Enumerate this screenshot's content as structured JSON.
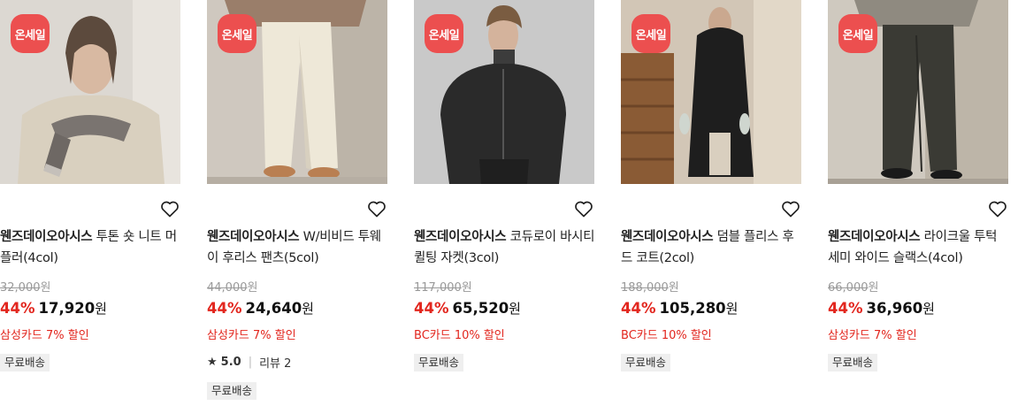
{
  "colors": {
    "sale_badge": "#ec4f4f",
    "discount": "#e2261e",
    "shipping_bg": "#efefef"
  },
  "products": [
    {
      "badge": "온세일",
      "brand": "웬즈데이오아시스",
      "name": " 투톤 숏 니트 머플러(4col)",
      "original_price": "32,000",
      "original_unit": "원",
      "discount": "44%",
      "price": "17,920",
      "price_unit": "원",
      "promo": "삼성카드 7% 할인",
      "rating": null,
      "shipping": "무료배송",
      "icons": [
        "heart-icon"
      ]
    },
    {
      "badge": "온세일",
      "brand": "웬즈데이오아시스",
      "name": " W/비비드 투웨이 후리스 팬츠(5col)",
      "original_price": "44,000",
      "original_unit": "원",
      "discount": "44%",
      "price": "24,640",
      "price_unit": "원",
      "promo": "삼성카드 7% 할인",
      "rating": {
        "star": "★",
        "score": "5.0",
        "sep": "|",
        "reviews": "리뷰 2"
      },
      "shipping": "무료배송",
      "icons": [
        "heart-icon",
        "star-icon"
      ]
    },
    {
      "badge": "온세일",
      "brand": "웬즈데이오아시스",
      "name": " 코듀로이 바시티 퀼팅 자켓(3col)",
      "original_price": "117,000",
      "original_unit": "원",
      "discount": "44%",
      "price": "65,520",
      "price_unit": "원",
      "promo": "BC카드 10% 할인",
      "rating": null,
      "shipping": "무료배송",
      "icons": [
        "heart-icon"
      ]
    },
    {
      "badge": "온세일",
      "brand": "웬즈데이오아시스",
      "name": " 덤블 플리스 후드 코트(2col)",
      "original_price": "188,000",
      "original_unit": "원",
      "discount": "44%",
      "price": "105,280",
      "price_unit": "원",
      "promo": "BC카드 10% 할인",
      "rating": null,
      "shipping": "무료배송",
      "icons": [
        "heart-icon"
      ]
    },
    {
      "badge": "온세일",
      "brand": "웬즈데이오아시스",
      "name": " 라이크울 투턱 세미 와이드 슬랙스(4col)",
      "original_price": "66,000",
      "original_unit": "원",
      "discount": "44%",
      "price": "36,960",
      "price_unit": "원",
      "promo": "삼성카드 7% 할인",
      "rating": null,
      "shipping": "무료배송",
      "icons": [
        "heart-icon"
      ]
    }
  ]
}
